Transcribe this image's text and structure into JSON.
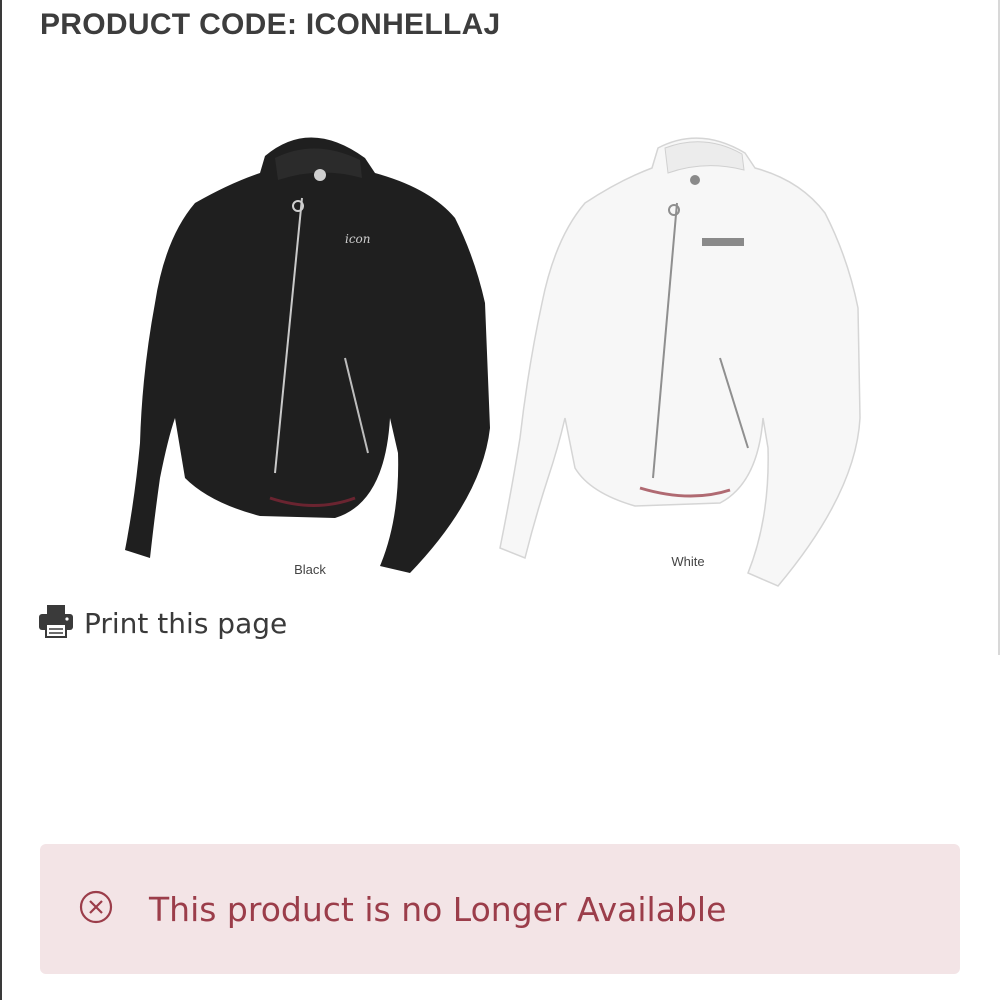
{
  "product": {
    "code_line": "PRODUCT CODE: ICONHELLAJ"
  },
  "image": {
    "variants": [
      {
        "label": "Black",
        "color": "#1e1e1e"
      },
      {
        "label": "White",
        "color": "#f6f6f6"
      }
    ],
    "brand_mark": "icon"
  },
  "actions": {
    "print_label": "Print this page",
    "print_icon": "printer-icon"
  },
  "alert": {
    "message": "This product is no Longer Available",
    "icon": "circle-x-icon",
    "background": "#f3e4e6",
    "text_color": "#9b3d4a"
  }
}
